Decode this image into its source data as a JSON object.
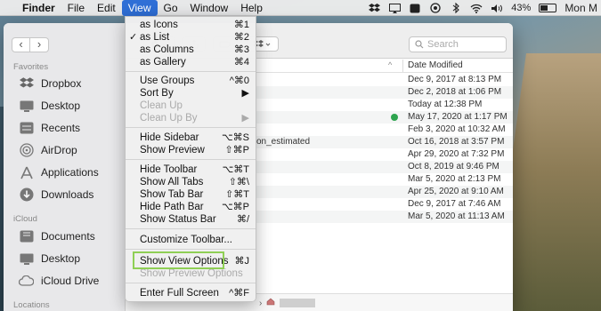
{
  "menubar": {
    "items": [
      {
        "label": "Finder",
        "bold": true
      },
      {
        "label": "File"
      },
      {
        "label": "Edit"
      },
      {
        "label": "View",
        "active": true
      },
      {
        "label": "Go"
      },
      {
        "label": "Window"
      },
      {
        "label": "Help"
      }
    ],
    "battery": "43%",
    "clock": "Mon M"
  },
  "view_menu": {
    "items": [
      {
        "label": "as Icons",
        "shortcut": "⌘1"
      },
      {
        "label": "as List",
        "shortcut": "⌘2",
        "checked": "✓"
      },
      {
        "label": "as Columns",
        "shortcut": "⌘3"
      },
      {
        "label": "as Gallery",
        "shortcut": "⌘4"
      },
      {
        "label": "Use Groups",
        "shortcut": "^⌘0"
      },
      {
        "label": "Sort By",
        "shortcut": "▶"
      },
      {
        "label": "Clean Up",
        "disabled": true
      },
      {
        "label": "Clean Up By",
        "shortcut": "▶",
        "disabled": true
      },
      {
        "label": "Hide Sidebar",
        "shortcut": "⌥⌘S"
      },
      {
        "label": "Show Preview",
        "shortcut": "⇧⌘P"
      },
      {
        "label": "Hide Toolbar",
        "shortcut": "⌥⌘T"
      },
      {
        "label": "Show All Tabs",
        "shortcut": "⇧⌘\\"
      },
      {
        "label": "Show Tab Bar",
        "shortcut": "⇧⌘T"
      },
      {
        "label": "Hide Path Bar",
        "shortcut": "⌥⌘P"
      },
      {
        "label": "Show Status Bar",
        "shortcut": "⌘/"
      },
      {
        "label": "Customize Toolbar..."
      },
      {
        "label": "Show View Options",
        "shortcut": "⌘J"
      },
      {
        "label": "Show Preview Options",
        "disabled": true
      },
      {
        "label": "Enter Full Screen",
        "shortcut": "^⌘F"
      }
    ]
  },
  "sidebar": {
    "favorites_label": "Favorites",
    "favorites": [
      "Dropbox",
      "Desktop",
      "Recents",
      "AirDrop",
      "Applications",
      "Downloads"
    ],
    "icloud_label": "iCloud",
    "icloud": [
      "Documents",
      "Desktop",
      "iCloud Drive"
    ],
    "locations_label": "Locations"
  },
  "toolbar": {
    "search_placeholder": "Search"
  },
  "list": {
    "date_header": "Date Modified",
    "partial_name": "on_estimated",
    "dates": [
      "Dec 9, 2017 at 8:13 PM",
      "Dec 2, 2018 at 1:06 PM",
      "Today at 12:38 PM",
      "May 17, 2020 at 1:17 PM",
      "Feb 3, 2020 at 10:32 AM",
      "Oct 16, 2018 at 3:57 PM",
      "Apr 29, 2020 at 7:32 PM",
      "Oct 8, 2019 at 9:46 PM",
      "Mar 5, 2020 at 2:13 PM",
      "Apr 25, 2020 at 9:10 AM",
      "Dec 9, 2017 at 7:46 AM",
      "Mar 5, 2020 at 11:13 AM"
    ]
  }
}
